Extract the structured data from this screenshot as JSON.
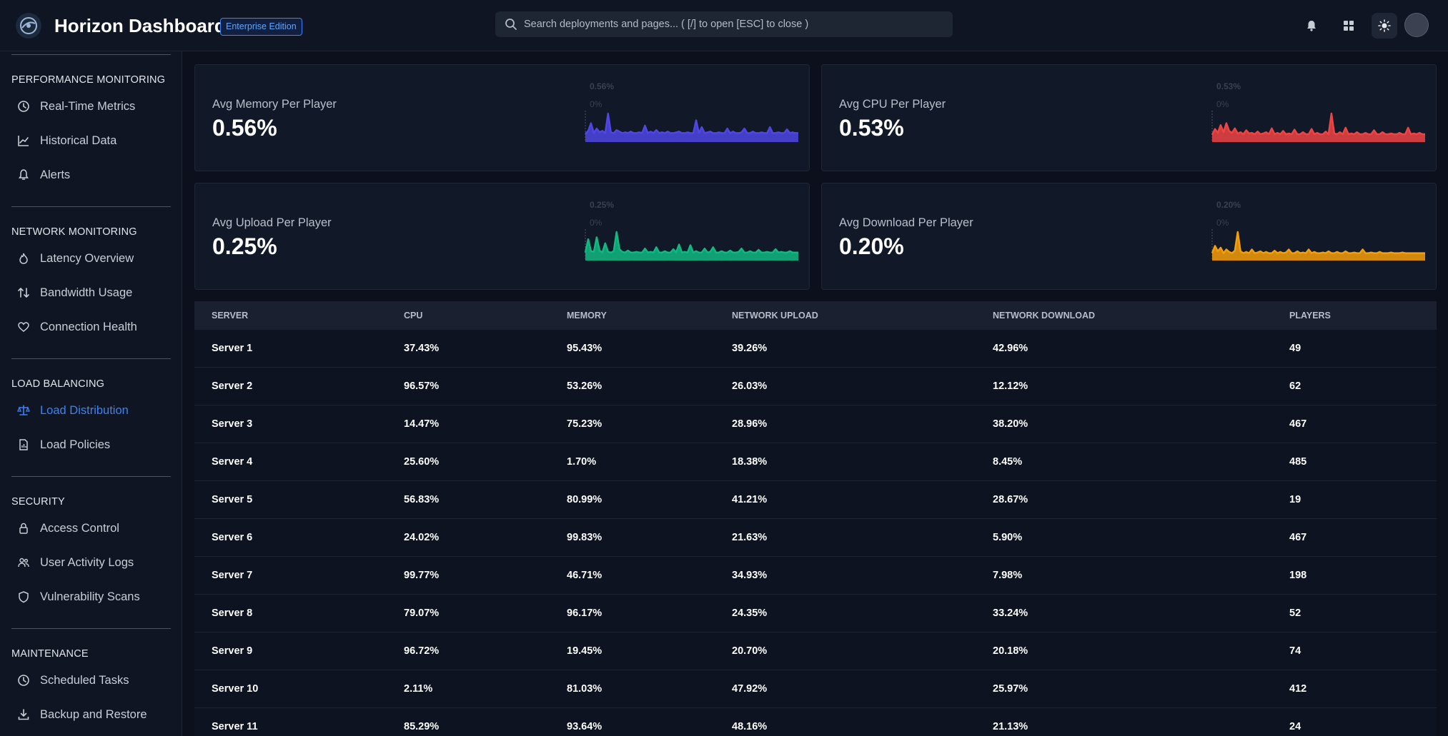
{
  "header": {
    "title": "Horizon Dashboard",
    "edition": "Enterprise Edition",
    "search_placeholder": "Search deployments and pages... ( [/] to open [ESC] to close )",
    "icons": [
      "logo-icon",
      "search-icon",
      "bell-icon",
      "grid-icon",
      "sun-icon",
      "avatar"
    ]
  },
  "sidebar": {
    "sections": [
      {
        "title": "PERFORMANCE MONITORING",
        "items": [
          {
            "label": "Real-Time Metrics",
            "icon": "clock-icon"
          },
          {
            "label": "Historical Data",
            "icon": "line-chart-icon"
          },
          {
            "label": "Alerts",
            "icon": "bell-icon"
          }
        ]
      },
      {
        "title": "NETWORK MONITORING",
        "items": [
          {
            "label": "Latency Overview",
            "icon": "flame-icon"
          },
          {
            "label": "Bandwidth Usage",
            "icon": "arrows-up-down-icon"
          },
          {
            "label": "Connection Health",
            "icon": "heart-icon"
          }
        ]
      },
      {
        "title": "LOAD BALANCING",
        "items": [
          {
            "label": "Load Distribution",
            "icon": "scale-icon",
            "active": true
          },
          {
            "label": "Load Policies",
            "icon": "document-chart-icon"
          }
        ]
      },
      {
        "title": "SECURITY",
        "items": [
          {
            "label": "Access Control",
            "icon": "lock-icon"
          },
          {
            "label": "User Activity Logs",
            "icon": "users-icon"
          },
          {
            "label": "Vulnerability Scans",
            "icon": "shield-icon"
          }
        ]
      },
      {
        "title": "MAINTENANCE",
        "items": [
          {
            "label": "Scheduled Tasks",
            "icon": "clock-icon"
          },
          {
            "label": "Backup and Restore",
            "icon": "download-icon"
          }
        ]
      }
    ]
  },
  "cards": [
    {
      "label": "Avg Memory Per Player",
      "value": "0.56%",
      "max_label": "0.56%",
      "min_label": "0%",
      "color": "#4f46e5",
      "series": [
        0.9,
        1.3,
        2.3,
        1.0,
        1.6,
        1.1,
        1.3,
        1.0,
        3.6,
        1.1,
        1.0,
        1.4,
        1.2,
        1.0,
        1.1,
        1.0,
        1.2,
        1.0,
        1.0,
        1.1,
        1.0,
        2.0,
        1.0,
        1.2,
        1.0,
        1.4,
        1.0,
        1.1,
        1.0,
        1.2,
        1.0,
        1.0,
        1.1,
        1.2,
        1.0,
        1.0,
        1.1,
        1.0,
        1.0,
        2.7,
        1.0,
        1.8,
        1.0,
        1.1,
        1.2,
        1.0,
        1.0,
        1.1,
        1.0,
        1.0,
        1.6,
        1.0,
        1.2,
        1.0,
        1.0,
        1.1,
        1.6,
        1.0,
        1.0,
        1.2,
        1.0,
        1.0,
        1.1,
        1.0,
        1.0,
        1.8,
        1.0,
        1.0,
        1.1,
        1.0,
        1.0,
        1.5,
        1.0,
        1.1,
        1.0,
        1.0
      ]
    },
    {
      "label": "Avg CPU Per Player",
      "value": "0.53%",
      "max_label": "0.53%",
      "min_label": "0%",
      "color": "#ef4444",
      "series": [
        0.9,
        1.8,
        1.2,
        2.4,
        1.3,
        2.7,
        1.5,
        1.2,
        1.9,
        1.1,
        1.3,
        1.0,
        1.6,
        1.1,
        1.2,
        1.0,
        1.4,
        1.0,
        1.1,
        1.3,
        1.0,
        1.9,
        1.0,
        1.2,
        1.0,
        1.5,
        1.0,
        1.1,
        1.0,
        1.7,
        1.0,
        1.0,
        1.3,
        1.0,
        1.0,
        1.8,
        1.0,
        1.2,
        1.0,
        1.0,
        1.4,
        1.0,
        4.2,
        1.1,
        1.0,
        1.3,
        1.0,
        2.0,
        1.0,
        1.1,
        1.0,
        1.3,
        1.0,
        1.0,
        1.2,
        1.0,
        1.0,
        1.6,
        1.0,
        1.0,
        1.3,
        1.0,
        1.0,
        1.1,
        1.0,
        1.0,
        1.2,
        1.0,
        1.0,
        2.0,
        1.0,
        1.1,
        1.0,
        1.2,
        1.0,
        1.0
      ]
    },
    {
      "label": "Avg Upload Per Player",
      "value": "0.25%",
      "max_label": "0.25%",
      "min_label": "0%",
      "color": "#10b981",
      "series": [
        1.0,
        3.0,
        1.2,
        1.1,
        3.3,
        1.3,
        1.0,
        2.4,
        1.1,
        1.0,
        1.2,
        4.1,
        1.5,
        1.1,
        1.0,
        1.3,
        1.0,
        1.0,
        1.1,
        1.0,
        1.0,
        1.6,
        1.0,
        1.1,
        1.0,
        1.8,
        1.0,
        1.0,
        1.2,
        1.0,
        1.0,
        1.5,
        1.0,
        2.2,
        1.0,
        1.1,
        1.0,
        2.1,
        1.0,
        1.2,
        1.0,
        1.0,
        1.6,
        1.0,
        1.1,
        1.8,
        1.0,
        1.0,
        1.2,
        1.0,
        1.0,
        1.3,
        1.0,
        1.0,
        1.1,
        1.6,
        1.0,
        1.0,
        1.2,
        1.0,
        1.0,
        1.4,
        1.0,
        1.0,
        1.1,
        1.0,
        1.0,
        1.5,
        1.0,
        1.1,
        1.0,
        1.0,
        1.2,
        1.0,
        1.0,
        1.0
      ]
    },
    {
      "label": "Avg Download Per Player",
      "value": "0.20%",
      "max_label": "0.20%",
      "min_label": "0%",
      "color": "#f59e0b",
      "series": [
        1.0,
        2.2,
        1.3,
        1.9,
        1.0,
        1.6,
        1.2,
        1.0,
        1.4,
        4.5,
        1.3,
        1.0,
        1.2,
        1.0,
        1.6,
        1.0,
        1.1,
        1.3,
        1.0,
        1.2,
        1.0,
        1.0,
        1.4,
        1.0,
        1.2,
        1.0,
        1.1,
        1.6,
        1.0,
        1.0,
        1.3,
        1.0,
        1.1,
        1.0,
        1.6,
        1.0,
        1.2,
        1.0,
        1.0,
        1.1,
        1.0,
        1.3,
        1.0,
        1.0,
        1.2,
        1.0,
        1.0,
        1.3,
        1.0,
        1.0,
        1.1,
        1.0,
        1.0,
        1.6,
        1.0,
        1.0,
        1.1,
        1.0,
        1.0,
        1.2,
        1.0,
        1.0,
        1.0,
        1.1,
        1.0,
        1.0,
        1.0,
        1.1,
        1.0,
        1.0,
        1.0,
        1.0,
        1.0,
        1.0,
        1.0,
        1.0
      ]
    }
  ],
  "table": {
    "columns": [
      "SERVER",
      "CPU",
      "MEMORY",
      "NETWORK UPLOAD",
      "NETWORK DOWNLOAD",
      "PLAYERS"
    ],
    "rows": [
      [
        "Server 1",
        "37.43%",
        "95.43%",
        "39.26%",
        "42.96%",
        "49"
      ],
      [
        "Server 2",
        "96.57%",
        "53.26%",
        "26.03%",
        "12.12%",
        "62"
      ],
      [
        "Server 3",
        "14.47%",
        "75.23%",
        "28.96%",
        "38.20%",
        "467"
      ],
      [
        "Server 4",
        "25.60%",
        "1.70%",
        "18.38%",
        "8.45%",
        "485"
      ],
      [
        "Server 5",
        "56.83%",
        "80.99%",
        "41.21%",
        "28.67%",
        "19"
      ],
      [
        "Server 6",
        "24.02%",
        "99.83%",
        "21.63%",
        "5.90%",
        "467"
      ],
      [
        "Server 7",
        "99.77%",
        "46.71%",
        "34.93%",
        "7.98%",
        "198"
      ],
      [
        "Server 8",
        "79.07%",
        "96.17%",
        "24.35%",
        "33.24%",
        "52"
      ],
      [
        "Server 9",
        "96.72%",
        "19.45%",
        "20.70%",
        "20.18%",
        "74"
      ],
      [
        "Server 10",
        "2.11%",
        "81.03%",
        "47.92%",
        "25.97%",
        "412"
      ],
      [
        "Server 11",
        "85.29%",
        "93.64%",
        "48.16%",
        "21.13%",
        "24"
      ]
    ]
  }
}
